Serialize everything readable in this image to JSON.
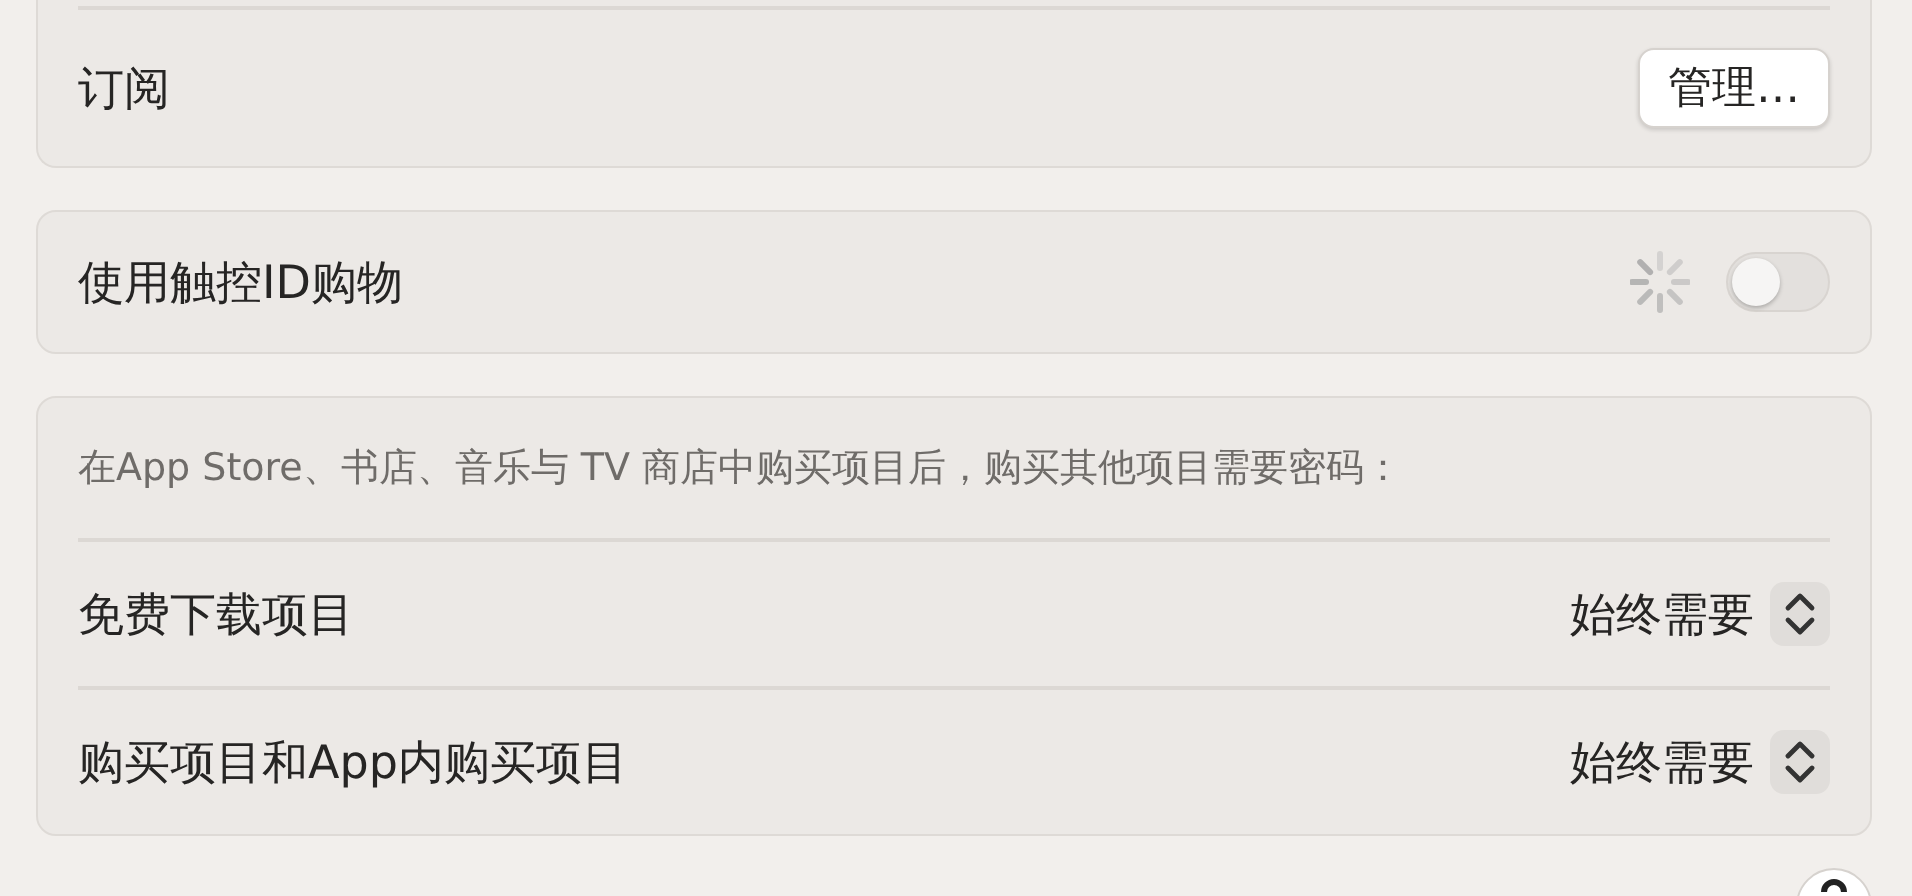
{
  "subscriptions": {
    "label": "订阅",
    "button": "管理…"
  },
  "touch_id_purchases": {
    "label": "使用触控ID购物",
    "on": false,
    "loading": true
  },
  "password_settings": {
    "description": "在App Store、书店、音乐与 TV 商店中购买项目后，购买其他项目需要密码：",
    "rows": [
      {
        "label": "免费下载项目",
        "value": "始终需要"
      },
      {
        "label": "购买项目和App内购买项目",
        "value": "始终需要"
      }
    ]
  }
}
